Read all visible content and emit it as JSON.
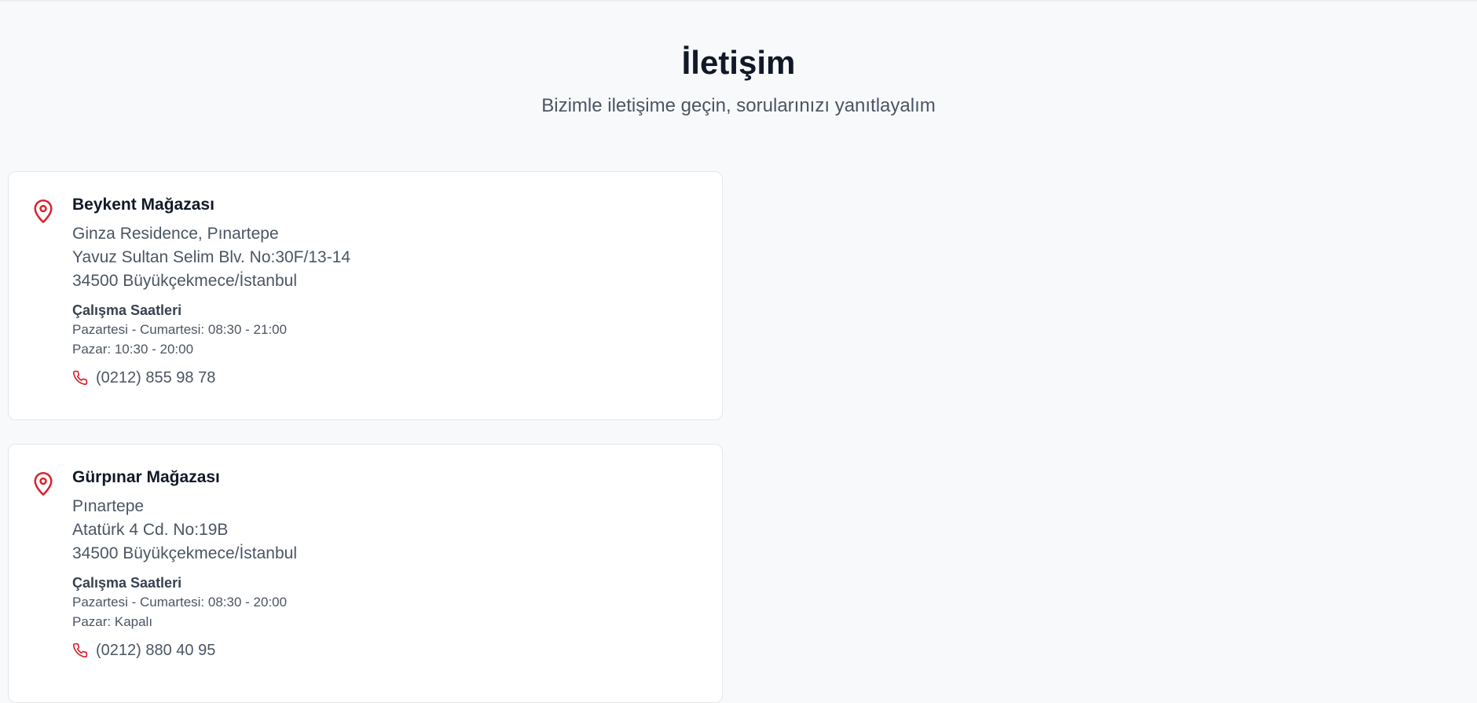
{
  "header": {
    "title": "İletişim",
    "subtitle": "Bizimle iletişime geçin, sorularınızı yanıtlayalım"
  },
  "colors": {
    "accent": "#d9232e",
    "background": "#f8f9fb",
    "card": "#ffffff"
  },
  "stores": [
    {
      "name": "Beykent Mağazası",
      "address": [
        "Ginza Residence, Pınartepe",
        "Yavuz Sultan Selim Blv. No:30F/13-14",
        "34500 Büyükçekmece/İstanbul"
      ],
      "hours_title": "Çalışma Saatleri",
      "hours": [
        "Pazartesi - Cumartesi: 08:30 - 21:00",
        "Pazar: 10:30 - 20:00"
      ],
      "phone": "(0212) 855 98 78",
      "icon": "map-pin-icon",
      "phone_icon": "phone-icon"
    },
    {
      "name": "Gürpınar Mağazası",
      "address": [
        "Pınartepe",
        "Atatürk 4 Cd. No:19B",
        "34500 Büyükçekmece/İstanbul"
      ],
      "hours_title": "Çalışma Saatleri",
      "hours": [
        "Pazartesi - Cumartesi: 08:30 - 20:00",
        "Pazar: Kapalı"
      ],
      "phone": "(0212) 880 40 95",
      "icon": "map-pin-icon",
      "phone_icon": "phone-icon"
    }
  ]
}
